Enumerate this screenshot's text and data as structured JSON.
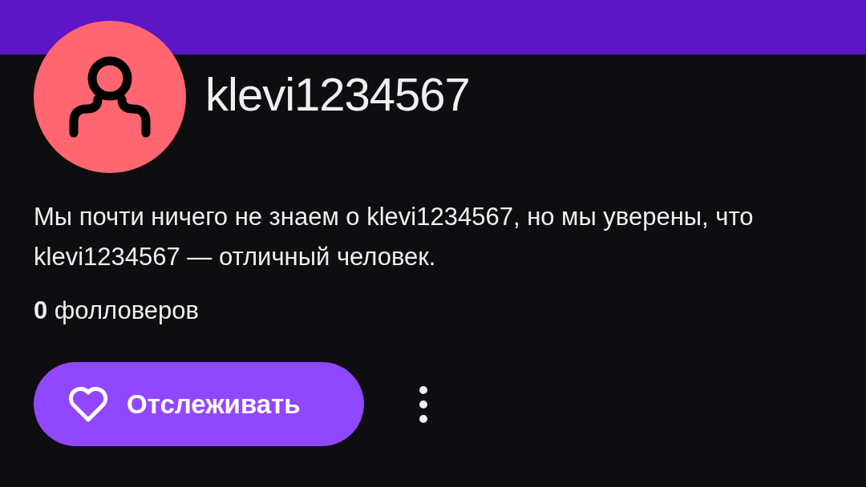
{
  "profile": {
    "username": "klevi1234567",
    "description": "Мы почти ничего не знаем о klevi1234567, но мы уверены, что klevi1234567 — отличный человек.",
    "followers": "**0** фолловеров"
  },
  "follow_button": {
    "label": "Отслеживать"
  }
}
